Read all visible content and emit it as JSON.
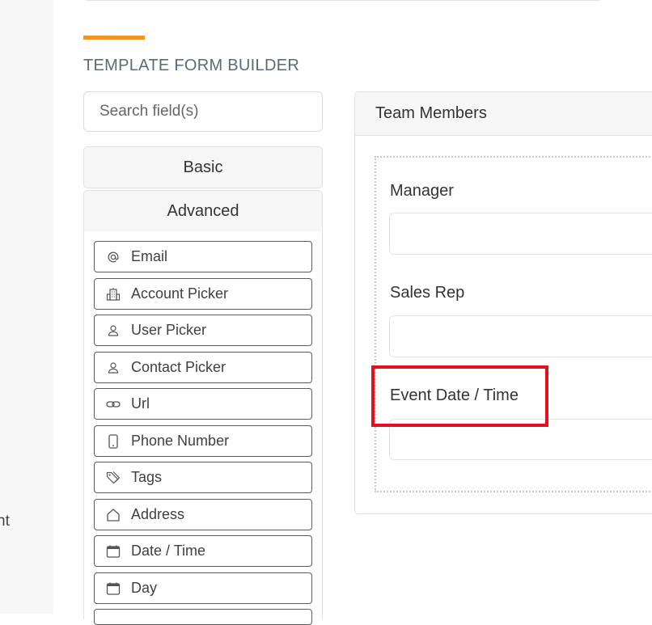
{
  "gutter": {
    "text": "nt"
  },
  "builder": {
    "title": "TEMPLATE FORM BUILDER",
    "search_placeholder": "Search field(s)",
    "sections": [
      "Basic",
      "Advanced"
    ],
    "fields": [
      {
        "label": "Email",
        "icon": "at-icon"
      },
      {
        "label": "Account Picker",
        "icon": "building-icon"
      },
      {
        "label": "User Picker",
        "icon": "user-icon"
      },
      {
        "label": "Contact Picker",
        "icon": "contact-icon"
      },
      {
        "label": "Url",
        "icon": "link-icon"
      },
      {
        "label": "Phone Number",
        "icon": "phone-icon"
      },
      {
        "label": "Tags",
        "icon": "tag-icon"
      },
      {
        "label": "Address",
        "icon": "home-icon"
      },
      {
        "label": "Date / Time",
        "icon": "calendar-icon"
      },
      {
        "label": "Day",
        "icon": "calendar-icon"
      }
    ]
  },
  "form": {
    "card_title": "Team Members",
    "fields": [
      {
        "label": "Manager"
      },
      {
        "label": "Sales Rep"
      },
      {
        "label": "Event Date / Time"
      }
    ]
  },
  "colors": {
    "accent": "#f39321",
    "highlight": "#e3101e"
  }
}
